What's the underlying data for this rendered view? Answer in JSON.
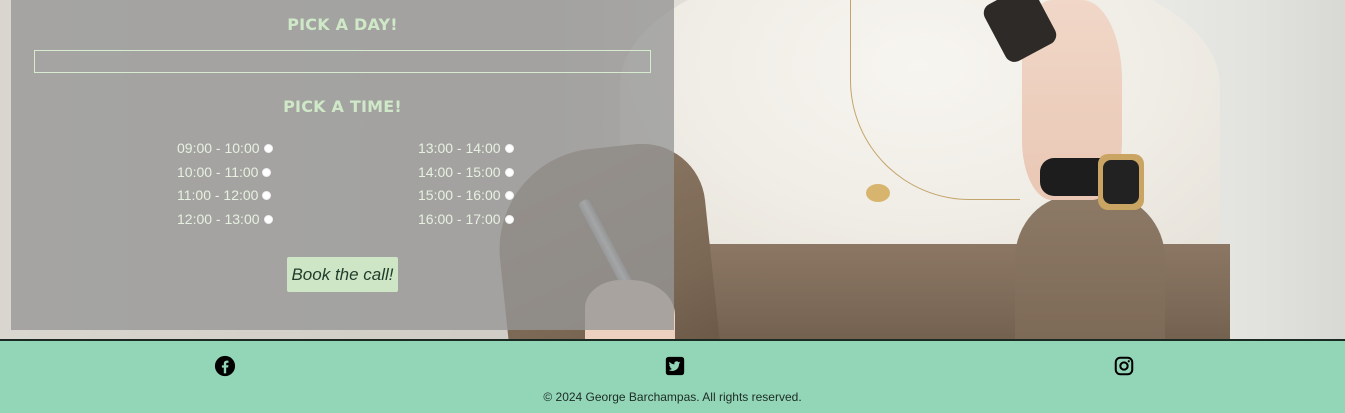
{
  "booking": {
    "pick_day_title": "PICK A DAY!",
    "date_value": "",
    "pick_time_title": "PICK A TIME!",
    "slots_left": [
      "09:00 - 10:00",
      "10:00 - 11:00",
      "11:00 - 12:00",
      "12:00 - 13:00"
    ],
    "slots_right": [
      "13:00 - 14:00",
      "14:00 - 15:00",
      "15:00 - 16:00",
      "16:00 - 17:00"
    ],
    "book_button_label": "Book the call!"
  },
  "footer": {
    "social_icons": [
      "facebook-icon",
      "twitter-icon",
      "instagram-icon"
    ],
    "copyright": "© 2024 George Barchampas. All rights reserved."
  },
  "colors": {
    "footer_bg": "#93d6b7",
    "panel_title": "#cfe9c8",
    "button_bg": "#cfe6c6"
  }
}
